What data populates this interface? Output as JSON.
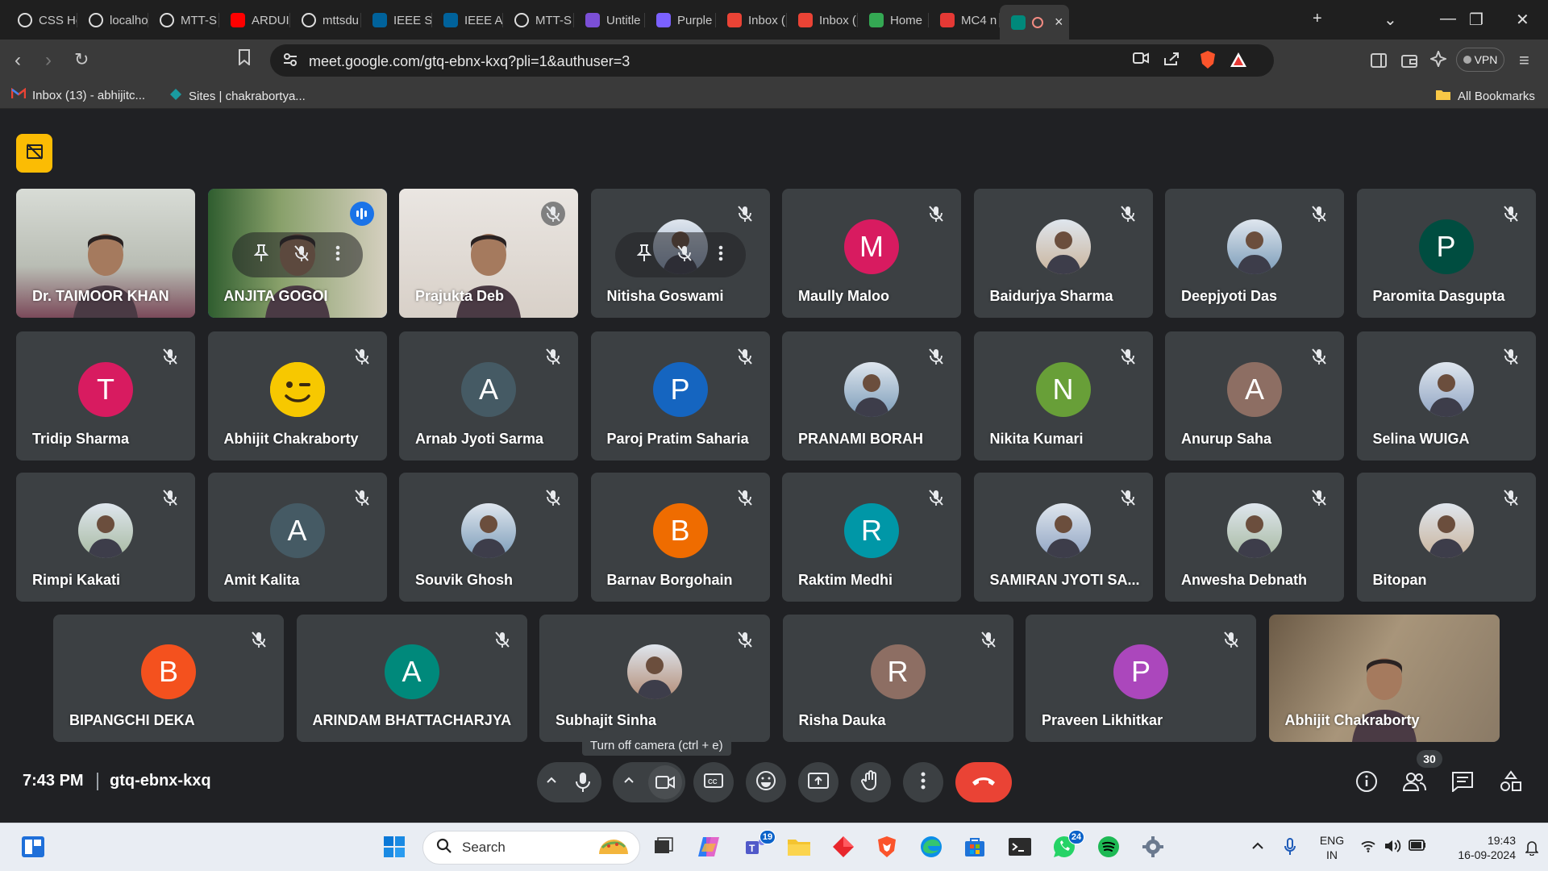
{
  "browser": {
    "tabs": [
      {
        "title": "CSS He",
        "icon": "chatgpt-icon",
        "color": "#ffffff"
      },
      {
        "title": "localho",
        "icon": "globe-icon",
        "color": "#ffffff"
      },
      {
        "title": "MTT-S",
        "icon": "chatgpt-icon",
        "color": "#ffffff"
      },
      {
        "title": "ARDUI",
        "icon": "youtube-icon",
        "color": "#ff0000"
      },
      {
        "title": "mttsdu",
        "icon": "triangle-icon",
        "color": "#ffffff"
      },
      {
        "title": "IEEE SA",
        "icon": "ieee-icon",
        "color": "#00629b"
      },
      {
        "title": "IEEE Av",
        "icon": "ieee-icon",
        "color": "#00629b"
      },
      {
        "title": "MTT-S",
        "icon": "chatgpt-icon",
        "color": "#ffffff"
      },
      {
        "title": "Untitle",
        "icon": "doc-icon",
        "color": "#7b4fd6"
      },
      {
        "title": "Purple",
        "icon": "copilot-icon",
        "color": "#7b61ff"
      },
      {
        "title": "Inbox (",
        "icon": "gmail-icon",
        "color": "#ea4335"
      },
      {
        "title": "Inbox (",
        "icon": "gmail-icon",
        "color": "#ea4335"
      },
      {
        "title": "Home",
        "icon": "drive-icon",
        "color": "#34a853"
      },
      {
        "title": "MC4 n",
        "icon": "record-icon",
        "color": "#e53935"
      },
      {
        "title": "",
        "icon": "meet-icon",
        "color": "#00897b",
        "active": true
      }
    ],
    "url": "meet.google.com/gtq-ebnx-kxq?pli=1&authuser=3",
    "vpn_label": "VPN",
    "bookmarks": [
      {
        "label": "Inbox (13) - abhijitc...",
        "icon": "gmail-icon"
      },
      {
        "label": "Sites | chakrabortya...",
        "icon": "sites-icon"
      }
    ],
    "all_bookmarks_label": "All Bookmarks"
  },
  "meet": {
    "participants": [
      {
        "name": "Dr. TAIMOOR KHAN",
        "type": "video",
        "muted": false
      },
      {
        "name": "ANJITA GOGOI",
        "type": "video",
        "speaking": true,
        "hover": true
      },
      {
        "name": "Prajukta Deb",
        "type": "video",
        "muted": true
      },
      {
        "name": "Nitisha Goswami",
        "type": "photo",
        "muted": true,
        "hover": true
      },
      {
        "name": "Maully Maloo",
        "type": "letter",
        "letter": "M",
        "color": "#d81b60",
        "muted": true
      },
      {
        "name": "Baidurjya Sharma",
        "type": "photo",
        "muted": true
      },
      {
        "name": "Deepjyoti Das",
        "type": "photo",
        "muted": true
      },
      {
        "name": "Paromita Dasgupta",
        "type": "letter",
        "letter": "P",
        "color": "#004d40",
        "muted": true
      },
      {
        "name": "Tridip Sharma",
        "type": "letter",
        "letter": "T",
        "color": "#d81b60",
        "muted": true
      },
      {
        "name": "Abhijit Chakraborty",
        "type": "emoji",
        "muted": true
      },
      {
        "name": "Arnab Jyoti Sarma",
        "type": "letter",
        "letter": "A",
        "color": "#455a64",
        "muted": true
      },
      {
        "name": "Paroj Pratim Saharia",
        "type": "letter",
        "letter": "P",
        "color": "#1565c0",
        "muted": true
      },
      {
        "name": "PRANAMI BORAH",
        "type": "photo",
        "muted": true
      },
      {
        "name": "Nikita Kumari",
        "type": "letter",
        "letter": "N",
        "color": "#689f38",
        "muted": true
      },
      {
        "name": "Anurup Saha",
        "type": "letter",
        "letter": "A",
        "color": "#8d6e63",
        "muted": true
      },
      {
        "name": "Selina WUIGA",
        "type": "photo",
        "muted": true
      },
      {
        "name": "Rimpi Kakati",
        "type": "photo",
        "muted": true
      },
      {
        "name": "Amit Kalita",
        "type": "letter",
        "letter": "A",
        "color": "#455a64",
        "muted": true
      },
      {
        "name": "Souvik Ghosh",
        "type": "photo",
        "muted": true
      },
      {
        "name": "Barnav Borgohain",
        "type": "letter",
        "letter": "B",
        "color": "#ef6c00",
        "muted": true
      },
      {
        "name": "Raktim Medhi",
        "type": "letter",
        "letter": "R",
        "color": "#0097a7",
        "muted": true
      },
      {
        "name": "SAMIRAN JYOTI SA...",
        "type": "photo",
        "muted": true
      },
      {
        "name": "Anwesha Debnath",
        "type": "photo",
        "muted": true
      },
      {
        "name": "Bitopan",
        "type": "photo",
        "muted": true
      },
      {
        "name": "BIPANGCHI DEKA",
        "type": "letter",
        "letter": "B",
        "color": "#f4511e",
        "muted": true
      },
      {
        "name": "ARINDAM BHATTACHARJYA",
        "type": "letter",
        "letter": "A",
        "color": "#00897b",
        "muted": true
      },
      {
        "name": "Subhajit Sinha",
        "type": "photo",
        "muted": true
      },
      {
        "name": "Risha Dauka",
        "type": "letter",
        "letter": "R",
        "color": "#8d6e63",
        "muted": true
      },
      {
        "name": "Praveen Likhitkar",
        "type": "letter",
        "letter": "P",
        "color": "#ab47bc",
        "muted": true
      },
      {
        "name": "Abhijit Chakraborty",
        "type": "video",
        "muted": false
      }
    ],
    "tooltip": "Turn off camera (ctrl + e)",
    "clock": "7:43 PM",
    "meeting_code": "gtq-ebnx-kxq",
    "people_count": "30",
    "colors": {
      "leave": "#ea4335",
      "tile": "#3c4043",
      "bg": "#202124",
      "speaking": "#1a73e8"
    }
  },
  "taskbar": {
    "search_placeholder": "Search",
    "teams_badge": "19",
    "whatsapp_badge": "24",
    "lang_line1": "ENG",
    "lang_line2": "IN",
    "time": "19:43",
    "date": "16-09-2024"
  }
}
